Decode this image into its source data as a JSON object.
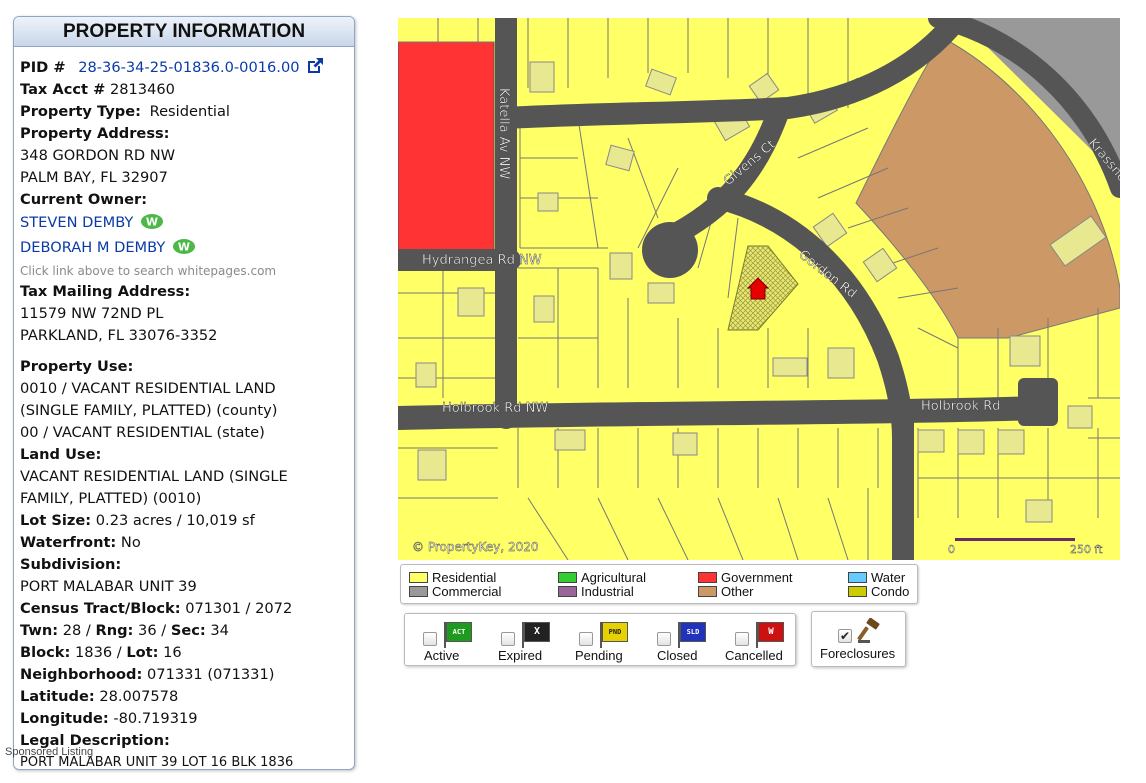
{
  "panel": {
    "title": "PROPERTY INFORMATION",
    "pid_label": "PID #",
    "pid_value": "28-36-34-25-01836.0-0016.00",
    "tax_acct_label": "Tax Acct #",
    "tax_acct_value": "2813460",
    "property_type_label": "Property Type:",
    "property_type_value": "Residential",
    "address_label": "Property Address:",
    "address_line1": "348 GORDON RD NW",
    "address_line2": "PALM BAY, FL 32907",
    "owner_label": "Current Owner:",
    "owners": [
      "STEVEN DEMBY",
      "DEBORAH M DEMBY"
    ],
    "owner_note": "Click link above to search whitepages.com",
    "mailing_label": "Tax Mailing Address:",
    "mailing_line1": "11579 NW 72ND PL",
    "mailing_line2": "PARKLAND, FL 33076-3352",
    "use_label": "Property Use:",
    "use_lines": [
      "0010 / VACANT RESIDENTIAL LAND",
      "(SINGLE FAMILY, PLATTED) (county)",
      "00 / VACANT RESIDENTIAL (state)"
    ],
    "land_use_label": "Land Use:",
    "land_use_lines": [
      "VACANT RESIDENTIAL LAND (SINGLE",
      "FAMILY, PLATTED) (0010)"
    ],
    "lot_size_label": "Lot Size:",
    "lot_size_value": "0.23 acres / 10,019 sf",
    "waterfront_label": "Waterfront:",
    "waterfront_value": "No",
    "subdivision_label": "Subdivision:",
    "subdivision_value": "PORT MALABAR UNIT 39",
    "census_label": "Census Tract/Block:",
    "census_value": "071301 / 2072",
    "twn_label": "Twn:",
    "twn_value": "28",
    "rng_label": "Rng:",
    "rng_value": "36",
    "sec_label": "Sec:",
    "sec_value": "34",
    "block_label": "Block:",
    "block_value": "1836",
    "lot_label": "Lot:",
    "lot_value": "16",
    "neighborhood_label": "Neighborhood:",
    "neighborhood_value": "071331 (071331)",
    "latitude_label": "Latitude:",
    "latitude_value": "28.007578",
    "longitude_label": "Longitude:",
    "longitude_value": "-80.719319",
    "legal_label": "Legal Description:",
    "legal_value": "PORT MALABAR UNIT 39 LOT 16 BLK 1836"
  },
  "sponsor": "Sponsored Listing",
  "map": {
    "streets": {
      "katella": "Katella Av NW",
      "givens": "Givens Ct",
      "hydrangea": "Hydrangea Rd NW",
      "gordon": "Gordon Rd",
      "holbrook_west": "Holbrook Rd NW",
      "holbrook_east": "Holbrook Rd",
      "krassner": "Krassner"
    },
    "copyright": "© PropertyKey, 2020",
    "scale_start": "0",
    "scale_end": "250 ft",
    "colors": {
      "residential": "#ffff66",
      "road": "#555555",
      "government": "#ff3333",
      "other": "#cc9966",
      "commercial": "#999999",
      "subject": "#d4d455"
    }
  },
  "legend": [
    {
      "label": "Residential",
      "color": "#ffff66"
    },
    {
      "label": "Commercial",
      "color": "#999999"
    },
    {
      "label": "Agricultural",
      "color": "#33cc33"
    },
    {
      "label": "Industrial",
      "color": "#996699"
    },
    {
      "label": "Government",
      "color": "#ff3333"
    },
    {
      "label": "Other",
      "color": "#cc9966"
    },
    {
      "label": "Water",
      "color": "#66ccff"
    },
    {
      "label": "Condo",
      "color": "#cccc00"
    }
  ],
  "filters": [
    {
      "label": "Active",
      "flag": "ACT",
      "flag_color": "#1e9a1e",
      "checked": false
    },
    {
      "label": "Expired",
      "flag": "X",
      "flag_color": "#222222",
      "checked": false
    },
    {
      "label": "Pending",
      "flag": "PND",
      "flag_color": "#e6d200",
      "checked": false
    },
    {
      "label": "Closed",
      "flag": "SLD",
      "flag_color": "#2233bb",
      "checked": false
    },
    {
      "label": "Cancelled",
      "flag": "W",
      "flag_color": "#cc1111",
      "checked": false
    }
  ],
  "foreclosures": {
    "label": "Foreclosures",
    "checked": true
  }
}
